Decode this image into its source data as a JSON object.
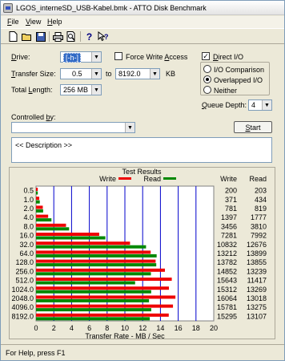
{
  "window": {
    "title": "LGOS_interneSD_USB-Kabel.bmk - ATTO Disk Benchmark"
  },
  "menu": {
    "file": "File",
    "view": "View",
    "help": "Help"
  },
  "toolbar": {
    "icons": [
      "new-icon",
      "open-icon",
      "save-icon",
      "print-icon",
      "print-preview-icon",
      "help-icon",
      "context-help-icon"
    ]
  },
  "form": {
    "drive_label": "Drive:",
    "drive_value": "[-h-]",
    "force_write_label": "Force Write Access",
    "force_write_checked": false,
    "direct_io_label": "Direct I/O",
    "direct_io_checked": true,
    "transfer_size_label": "Transfer Size:",
    "transfer_from": "0.5",
    "to_label": "to",
    "transfer_to": "8192.0",
    "transfer_unit": "KB",
    "total_length_label": "Total Length:",
    "total_length_value": "256 MB",
    "io_options": [
      "I/O Comparison",
      "Overlapped I/O",
      "Neither"
    ],
    "io_selected": "Overlapped I/O",
    "queue_depth_label": "Queue Depth:",
    "queue_depth_value": "4",
    "controlled_by_label": "Controlled by:",
    "controlled_by_value": "",
    "start_label": "Start",
    "description_text": "<< Description >>"
  },
  "chart_data": {
    "type": "bar",
    "title": "Test Results",
    "legend": [
      {
        "name": "Write",
        "color": "#ee0000"
      },
      {
        "name": "Read",
        "color": "#008800"
      }
    ],
    "legend_placement": "top",
    "xlabel": "Transfer Rate - MB / Sec",
    "xlim": [
      0,
      20
    ],
    "xticks": [
      "0",
      "2",
      "4",
      "6",
      "8",
      "10",
      "12",
      "14",
      "16",
      "18",
      "20"
    ],
    "categories": [
      "0.5",
      "1.0",
      "2.0",
      "4.0",
      "8.0",
      "16.0",
      "32.0",
      "64.0",
      "128.0",
      "256.0",
      "512.0",
      "1024.0",
      "2048.0",
      "4096.0",
      "8192.0"
    ],
    "column_headers": [
      "Write",
      "Read"
    ],
    "series": [
      {
        "name": "Write",
        "color": "#ee0000",
        "values": [
          200,
          371,
          781,
          1397,
          3456,
          7281,
          10832,
          13212,
          13782,
          14852,
          15643,
          15312,
          16064,
          15781,
          15295
        ]
      },
      {
        "name": "Read",
        "color": "#008800",
        "values": [
          203,
          434,
          819,
          1777,
          3810,
          7992,
          12676,
          13899,
          13855,
          13239,
          11417,
          13269,
          13018,
          13275,
          13107
        ]
      }
    ],
    "grid": true
  },
  "status": {
    "text": "For Help, press F1"
  }
}
